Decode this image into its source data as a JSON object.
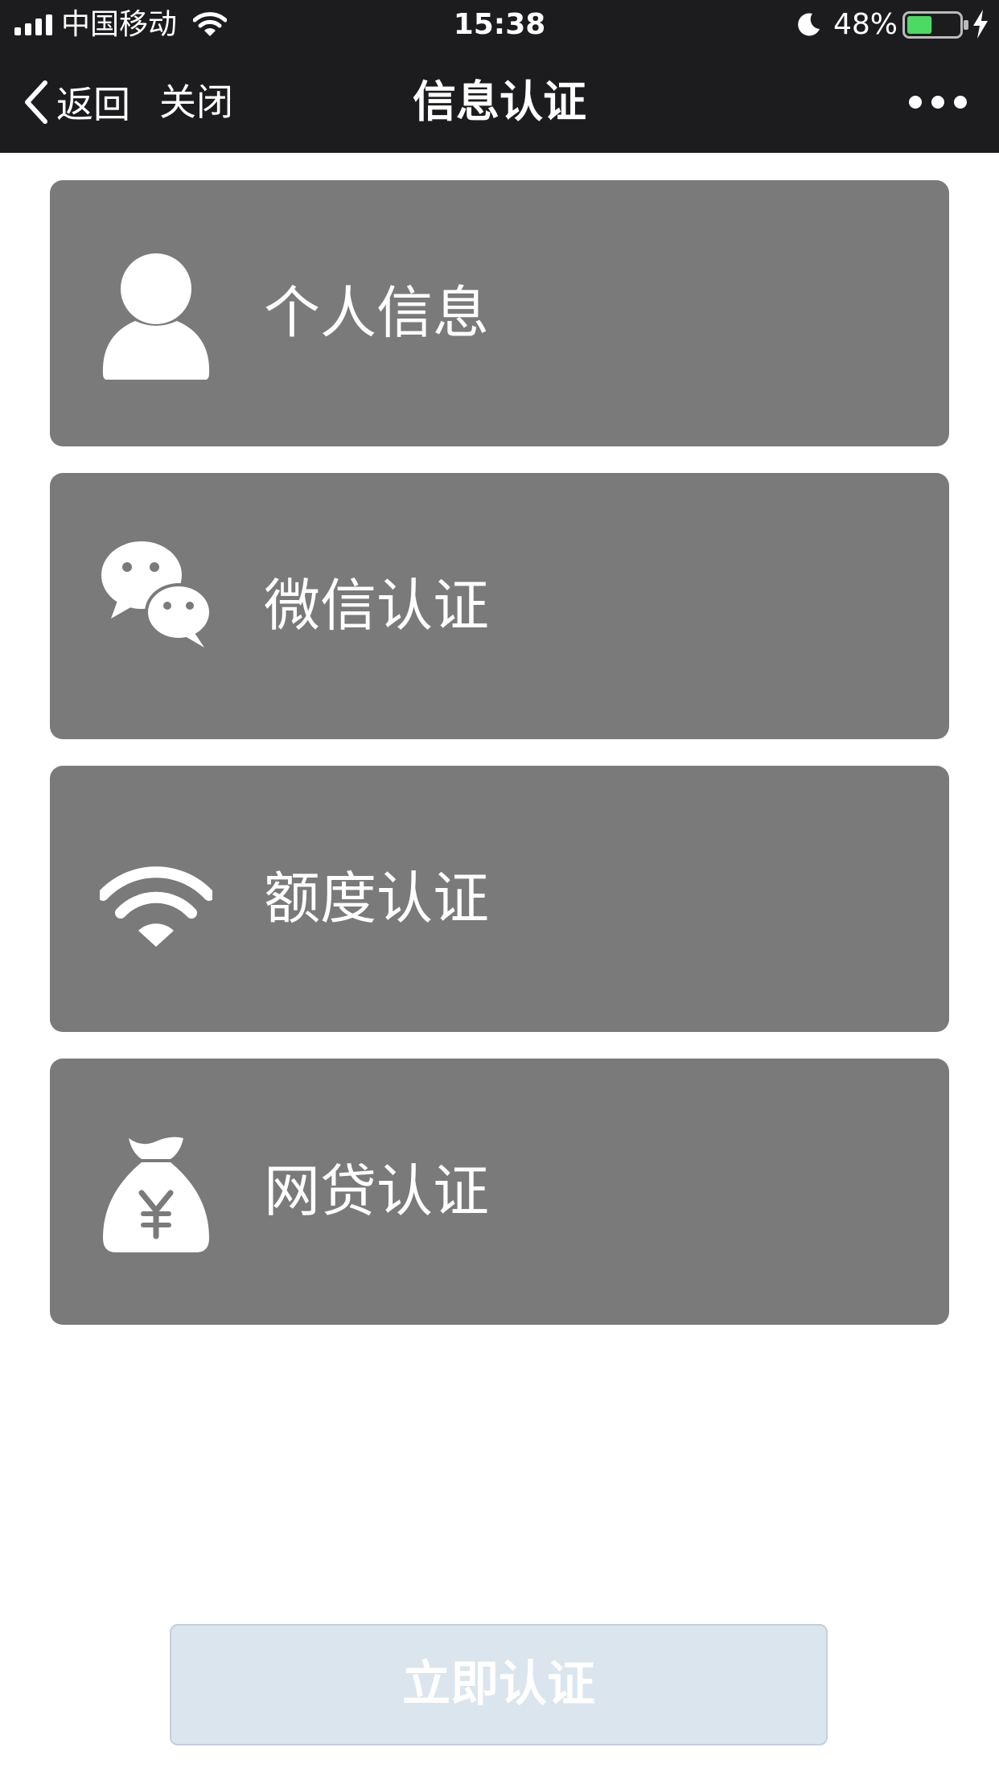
{
  "status_bar": {
    "carrier": "中国移动",
    "time": "15:38",
    "battery_percent": "48%",
    "battery_level": 0.48,
    "battery_color": "#4cd964"
  },
  "nav": {
    "back_label": "返回",
    "close_label": "关闭",
    "title": "信息认证",
    "more_icon": "more-dots-icon"
  },
  "cards": [
    {
      "label": "个人信息",
      "icon": "person-icon"
    },
    {
      "label": "微信认证",
      "icon": "wechat-icon"
    },
    {
      "label": "额度认证",
      "icon": "wifi-icon"
    },
    {
      "label": "网贷认证",
      "icon": "money-bag-icon"
    }
  ],
  "submit": {
    "label": "立即认证"
  },
  "colors": {
    "nav_background": "#1c1c1e",
    "card_background": "#7a7a7a",
    "button_background": "#dbe5ee"
  }
}
